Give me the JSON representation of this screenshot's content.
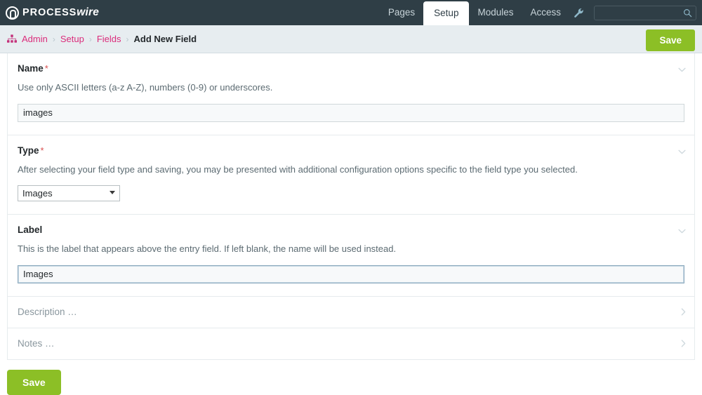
{
  "masthead": {
    "logo": {
      "primary": "PROCESS",
      "secondary": "wire",
      "mark_icon": "processwire-logo-icon"
    },
    "nav_items": [
      {
        "label": "Pages",
        "active": false
      },
      {
        "label": "Setup",
        "active": true
      },
      {
        "label": "Modules",
        "active": false
      },
      {
        "label": "Access",
        "active": false
      }
    ],
    "wrench_icon": "wrench-icon",
    "search": {
      "value": "",
      "placeholder": "",
      "icon": "search-icon"
    }
  },
  "breadcrumb": {
    "home_icon": "sitemap-icon",
    "separator": "›",
    "items": [
      {
        "label": "Admin",
        "current": false
      },
      {
        "label": "Setup",
        "current": false
      },
      {
        "label": "Fields",
        "current": false
      },
      {
        "label": "Add New Field",
        "current": true
      }
    ]
  },
  "actions": {
    "save_top_label": "Save",
    "save_bottom_label": "Save"
  },
  "form": {
    "sections": [
      {
        "id": "name",
        "label": "Name",
        "required": true,
        "required_marker": "*",
        "description": "Use only ASCII letters (a-z A-Z), numbers (0-9) or underscores.",
        "value": "images",
        "placeholder": "",
        "control": "text",
        "collapsed": false,
        "chevron": "chevron-down-icon"
      },
      {
        "id": "type",
        "label": "Type",
        "required": true,
        "required_marker": "*",
        "description": "After selecting your field type and saving, you may be presented with additional configuration options specific to the field type you selected.",
        "value": "Images",
        "control": "select",
        "collapsed": false,
        "chevron": "chevron-down-icon"
      },
      {
        "id": "label",
        "label": "Label",
        "required": false,
        "required_marker": "",
        "description": "This is the label that appears above the entry field. If left blank, the name will be used instead.",
        "value": "Images",
        "placeholder": "",
        "control": "text",
        "focused": true,
        "collapsed": false,
        "chevron": "chevron-down-icon"
      },
      {
        "id": "description",
        "label": "Description …",
        "collapsed": true,
        "chevron": "chevron-right-icon"
      },
      {
        "id": "notes",
        "label": "Notes …",
        "collapsed": true,
        "chevron": "chevron-right-icon"
      }
    ]
  },
  "colors": {
    "masthead_bg": "#2f3e46",
    "breadbar_bg": "#e7edf0",
    "accent_pink": "#db2c7b",
    "save_green": "#8cbf26",
    "required_red": "#d94f4f"
  }
}
